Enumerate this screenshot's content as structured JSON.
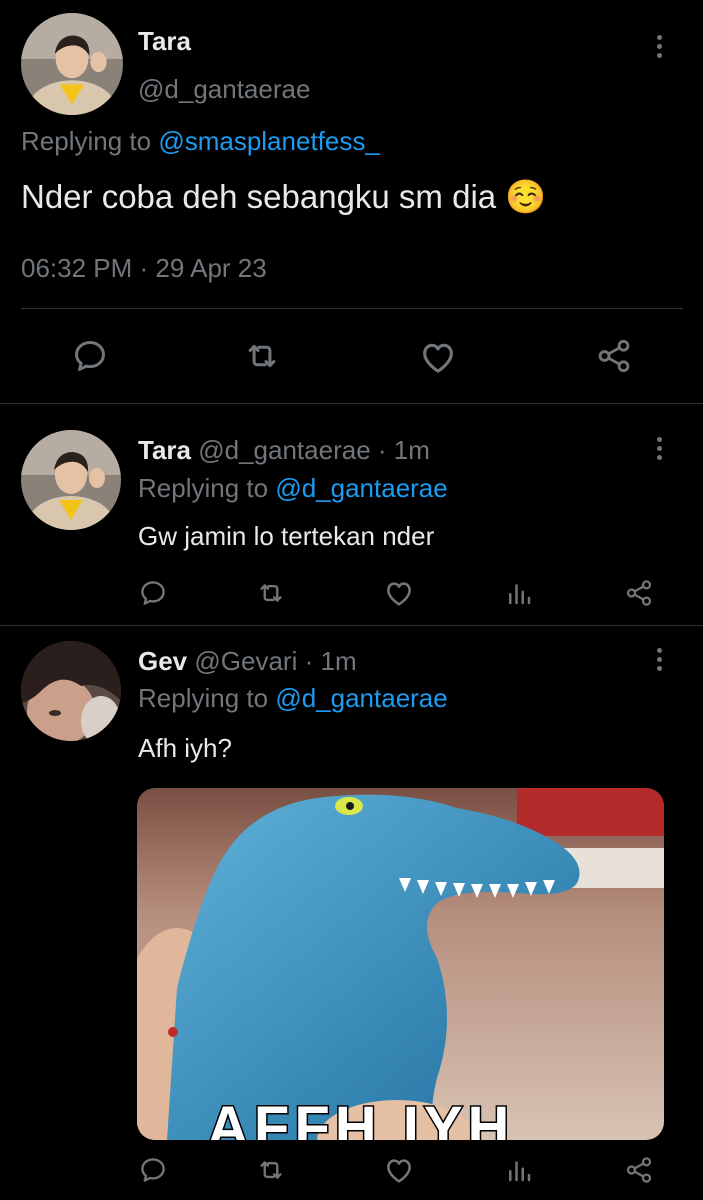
{
  "main_tweet": {
    "display_name": "Tara",
    "handle": "@d_gantaerae",
    "replying_prefix": "Replying to ",
    "replying_handle": "@smasplanetfess_",
    "text": "Nder coba deh sebangku sm dia ☺️",
    "timestamp": "06:32 PM · 29 Apr 23",
    "actions": [
      "reply-icon",
      "retweet-icon",
      "like-icon",
      "share-icon"
    ]
  },
  "replies": [
    {
      "display_name": "Tara",
      "handle": "@d_gantaerae",
      "time": "· 1m",
      "replying_prefix": "Replying to ",
      "replying_handle": "@d_gantaerae",
      "text": "Gw jamin lo tertekan nder",
      "actions": [
        "reply-icon",
        "retweet-icon",
        "like-icon",
        "analytics-icon",
        "share-icon"
      ]
    },
    {
      "display_name": "Gev",
      "handle": "@Gevari",
      "time": "· 1m",
      "replying_prefix": "Replying to ",
      "replying_handle": "@d_gantaerae",
      "text": "Afh iyh?",
      "media": {
        "description_icon": "blue-dinosaur-toy-meme-image",
        "caption": "AFFH IYH"
      },
      "actions": [
        "reply-icon",
        "retweet-icon",
        "like-icon",
        "analytics-icon",
        "share-icon"
      ]
    }
  ],
  "colors": {
    "background": "#000000",
    "text": "#e7e9ea",
    "secondary": "#71767b",
    "link": "#1d9bf0",
    "divider": "#2f3336"
  }
}
